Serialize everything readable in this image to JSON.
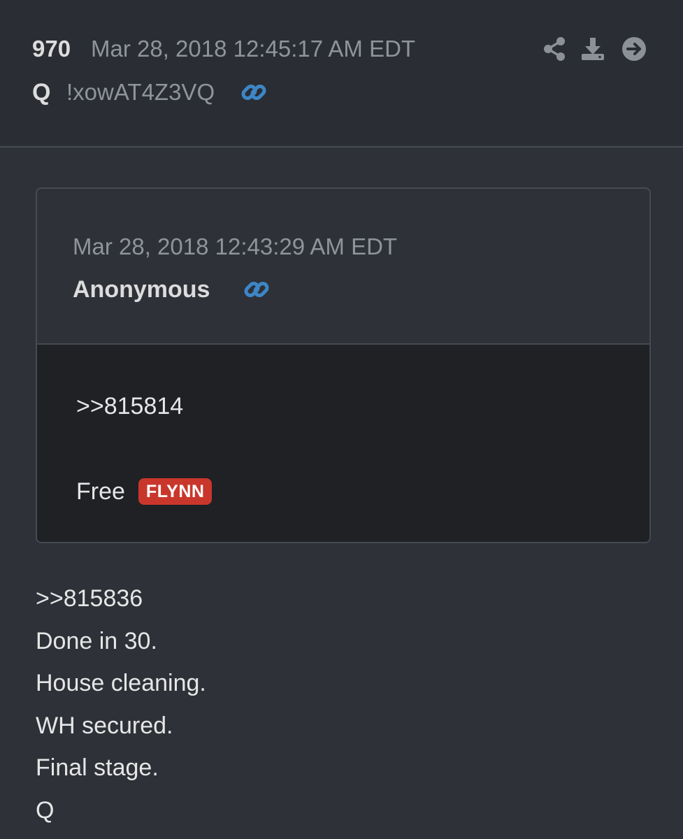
{
  "post": {
    "number": "970",
    "timestamp": "Mar 28, 2018 12:45:17 AM EDT",
    "author": "Q",
    "tripcode": "!xowAT4Z3VQ",
    "link_icon": "link-icon",
    "actions": [
      {
        "icon": "share-icon"
      },
      {
        "icon": "download-icon"
      },
      {
        "icon": "forward-icon"
      }
    ]
  },
  "quoted": {
    "timestamp": "Mar 28, 2018 12:43:29 AM EDT",
    "author": "Anonymous",
    "link_icon": "link-icon",
    "ref": ">>815814",
    "free_text": "Free",
    "badge": "FLYNN"
  },
  "message": {
    "lines": [
      ">>815836",
      "Done in 30.",
      "House cleaning.",
      "WH secured.",
      "Final stage.",
      "Q"
    ]
  },
  "colors": {
    "background": "#2e3138",
    "header_background": "#2a2d33",
    "quoted_body_background": "#1f2125",
    "muted_text": "#8f949c",
    "text": "#e6e6e6",
    "link_accent": "#3d86c6",
    "icon_gray": "#8c9199",
    "badge_red": "#c9372c"
  }
}
